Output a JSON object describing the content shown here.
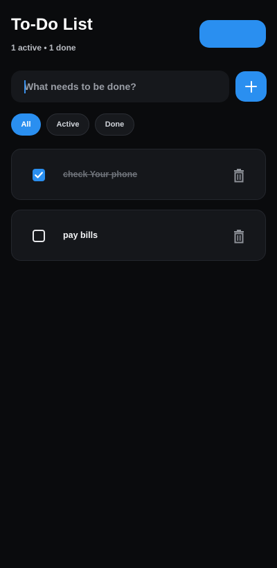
{
  "header": {
    "title": "To-Do List",
    "subtitle": "1 active • 1 done"
  },
  "composer": {
    "placeholder": "What needs to be done?",
    "value": ""
  },
  "filters": [
    {
      "label": "All",
      "selected": true
    },
    {
      "label": "Active",
      "selected": false
    },
    {
      "label": "Done",
      "selected": false
    }
  ],
  "tasks": [
    {
      "text": "check Your phone",
      "done": true
    },
    {
      "text": "pay bills",
      "done": false
    }
  ],
  "colors": {
    "accent": "#2a8ff0",
    "background": "#0a0b0d",
    "card": "#15171b"
  },
  "icons": {
    "add": "plus-icon",
    "delete": "trash-icon",
    "checked": "checkbox-checked-icon",
    "unchecked": "checkbox-unchecked-icon"
  }
}
